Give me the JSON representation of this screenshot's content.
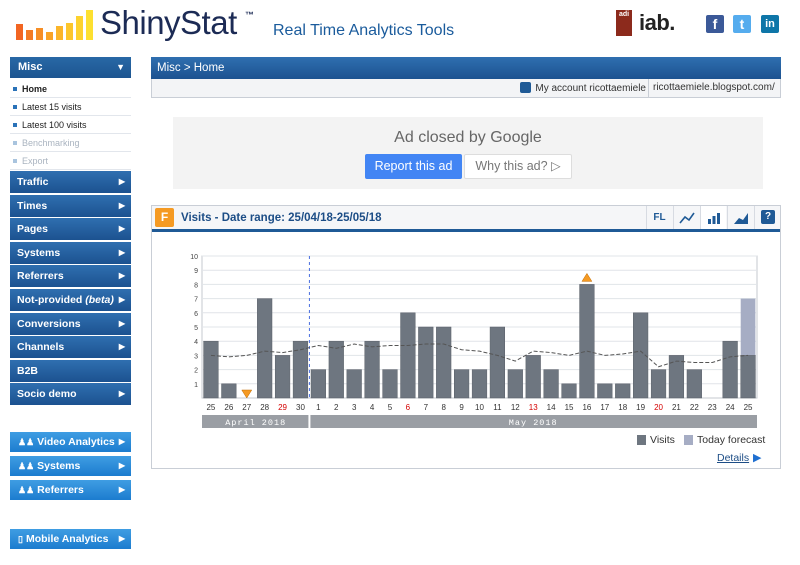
{
  "header": {
    "logo_text": "ShinyStat",
    "logo_tm": "™",
    "tagline": "Real Time Analytics Tools",
    "iab_badge": "adi",
    "iab_text": "iab.",
    "social": [
      "f",
      "t",
      "in"
    ]
  },
  "sidebar": {
    "misc_title": "Misc",
    "misc_items": [
      {
        "label": "Home",
        "state": "active"
      },
      {
        "label": "Latest 15 visits",
        "state": "normal"
      },
      {
        "label": "Latest 100 visits",
        "state": "normal"
      },
      {
        "label": "Benchmarking",
        "state": "disabled"
      },
      {
        "label": "Export",
        "state": "disabled"
      }
    ],
    "categories": [
      "Traffic",
      "Times",
      "Pages",
      "Systems",
      "Referrers",
      "Not-provided (beta)",
      "Conversions",
      "Channels",
      "B2B",
      "Socio demo"
    ],
    "video_section": [
      "Video Analytics",
      "Systems",
      "Referrers"
    ],
    "mobile": "Mobile Analytics"
  },
  "breadcrumb": "Misc > Home",
  "account": {
    "user": "My account ricottaemiele",
    "site": "ricottaemiele.blogspot.com/"
  },
  "ad": {
    "title": "Ad closed by Google",
    "report": "Report this ad",
    "why": "Why this ad? ▷"
  },
  "panel": {
    "icon": "F",
    "title": "Visits - Date range: 25/04/18-25/05/18",
    "buttons": [
      "FL",
      "line-chart-icon",
      "bar-chart-icon",
      "area-chart-icon",
      "?"
    ],
    "legend": {
      "visits": "Visits",
      "forecast": "Today forecast"
    },
    "details": "Details"
  },
  "colors": {
    "bar": "#6e7680",
    "forecast": "#a6adc4",
    "accent": "#1f5a96",
    "weekend": "#d40000"
  },
  "chart_data": {
    "type": "bar",
    "ylim": [
      0,
      10
    ],
    "yticks": [
      1,
      2,
      3,
      4,
      5,
      6,
      7,
      8,
      9,
      10
    ],
    "categories": [
      "25",
      "26",
      "27",
      "28",
      "29",
      "30",
      "1",
      "2",
      "3",
      "4",
      "5",
      "6",
      "7",
      "8",
      "9",
      "10",
      "11",
      "12",
      "13",
      "14",
      "15",
      "16",
      "17",
      "18",
      "19",
      "20",
      "21",
      "22",
      "23",
      "24",
      "25"
    ],
    "red_days": [
      "29",
      "6",
      "13",
      "20"
    ],
    "series": [
      {
        "name": "Visits",
        "values": [
          4,
          1,
          0,
          7,
          3,
          4,
          2,
          4,
          2,
          4,
          2,
          6,
          5,
          5,
          2,
          2,
          5,
          2,
          3,
          2,
          1,
          8,
          1,
          1,
          6,
          2,
          3,
          2,
          0,
          4,
          3
        ]
      },
      {
        "name": "Today forecast",
        "values": [
          0,
          0,
          0,
          0,
          0,
          0,
          0,
          0,
          0,
          0,
          0,
          0,
          0,
          0,
          0,
          0,
          0,
          0,
          0,
          0,
          0,
          0,
          0,
          0,
          0,
          0,
          0,
          0,
          0,
          0,
          4
        ]
      }
    ],
    "trend": [
      3.0,
      2.9,
      3.0,
      3.3,
      3.2,
      3.4,
      3.7,
      3.5,
      3.8,
      3.6,
      3.7,
      3.7,
      3.8,
      3.8,
      3.4,
      3.3,
      3.0,
      2.6,
      3.3,
      3.2,
      3.0,
      3.3,
      3.0,
      3.1,
      3.3,
      2.2,
      2.6,
      2.5,
      2.5,
      2.9,
      3.0
    ],
    "markers": {
      "min_index": 2,
      "max_index": 21
    },
    "months": [
      {
        "label": "April 2018",
        "count": 6
      },
      {
        "label": "May 2018",
        "count": 25
      }
    ]
  }
}
